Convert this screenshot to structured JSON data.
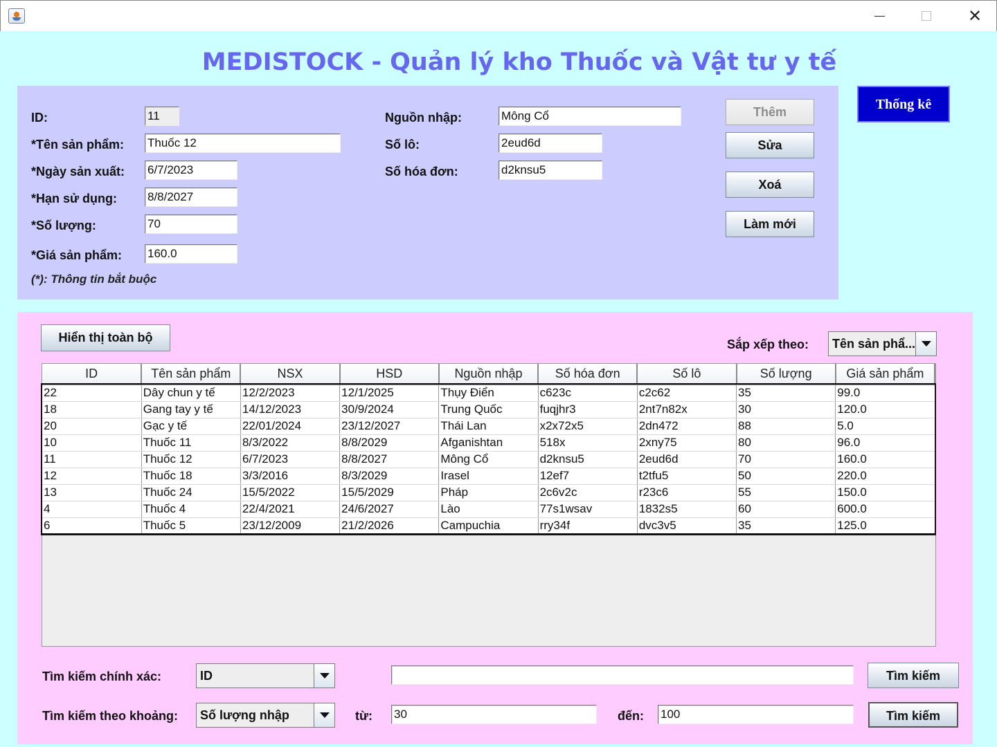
{
  "window": {
    "minimize": "—",
    "maximize": "□",
    "close": "✕"
  },
  "title": "MEDISTOCK - Quản lý kho Thuốc và Vật tư y tế",
  "form": {
    "id_label": "ID:",
    "id_value": "11",
    "name_label": "*Tên sản phẩm:",
    "name_value": "Thuốc 12",
    "mfg_label": "*Ngày sản xuất:",
    "mfg_value": "6/7/2023",
    "exp_label": "*Hạn sử dụng:",
    "exp_value": "8/8/2027",
    "qty_label": "*Số lượng:",
    "qty_value": "70",
    "price_label": "*Giá sản phẩm:",
    "price_value": "160.0",
    "source_label": "Nguồn nhập:",
    "source_value": "Mông Cổ",
    "lot_label": "Số lô:",
    "lot_value": "2eud6d",
    "invoice_label": "Số hóa đơn:",
    "invoice_value": "d2knsu5",
    "note": "(*): Thông tin bắt buộc"
  },
  "actions": {
    "add": "Thêm",
    "edit": "Sửa",
    "delete": "Xoá",
    "refresh": "Làm mới",
    "stats": "Thống kê"
  },
  "list": {
    "show_all": "Hiển thị toàn bộ",
    "sort_label": "Sắp xếp theo:",
    "sort_value": "Tên sản phẩ...",
    "columns": [
      "ID",
      "Tên sản phẩm",
      "NSX",
      "HSD",
      "Nguồn nhập",
      "Số hóa đơn",
      "Số lô",
      "Số lượng",
      "Giá sản phẩm"
    ],
    "rows": [
      [
        "22",
        "Dây chun y tế",
        "12/2/2023",
        "12/1/2025",
        "Thụy Điển",
        "c623c",
        "c2c62",
        "35",
        "99.0"
      ],
      [
        "18",
        "Gang tay y tế",
        "14/12/2023",
        "30/9/2024",
        "Trung Quốc",
        "fuqjhr3",
        "2nt7n82x",
        "30",
        "120.0"
      ],
      [
        "20",
        "Gạc y tế",
        "22/01/2024",
        "23/12/2027",
        "Thái Lan",
        "x2x72x5",
        "2dn472",
        "88",
        "5.0"
      ],
      [
        "10",
        "Thuốc 11",
        "8/3/2022",
        "8/8/2029",
        "Afganishtan",
        "518x",
        "2xny75",
        "80",
        "96.0"
      ],
      [
        "11",
        "Thuốc 12",
        "6/7/2023",
        "8/8/2027",
        "Mông Cổ",
        "d2knsu5",
        "2eud6d",
        "70",
        "160.0"
      ],
      [
        "12",
        "Thuốc 18",
        "3/3/2016",
        "8/3/2029",
        "Irasel",
        "12ef7",
        "t2tfu5",
        "50",
        "220.0"
      ],
      [
        "13",
        "Thuốc 24",
        "15/5/2022",
        "15/5/2029",
        "Pháp",
        "2c6v2c",
        "r23c6",
        "55",
        "150.0"
      ],
      [
        "4",
        "Thuốc 4",
        "22/4/2021",
        "24/6/2027",
        "Lào",
        "77s1wsav",
        "1832s5",
        "60",
        "600.0"
      ],
      [
        "6",
        "Thuốc 5",
        "23/12/2009",
        "21/2/2026",
        "Campuchia",
        "rry34f",
        "dvc3v5",
        "35",
        "125.0"
      ]
    ]
  },
  "search": {
    "exact_label": "Tìm kiếm chính xác:",
    "exact_field": "ID",
    "exact_value": "",
    "exact_button": "Tìm kiếm",
    "range_label": "Tìm kiếm theo khoảng:",
    "range_field": "Số lượng nhập",
    "from_label": "từ:",
    "from_value": "30",
    "to_label": "đến:",
    "to_value": "100",
    "range_button": "Tìm kiếm"
  }
}
